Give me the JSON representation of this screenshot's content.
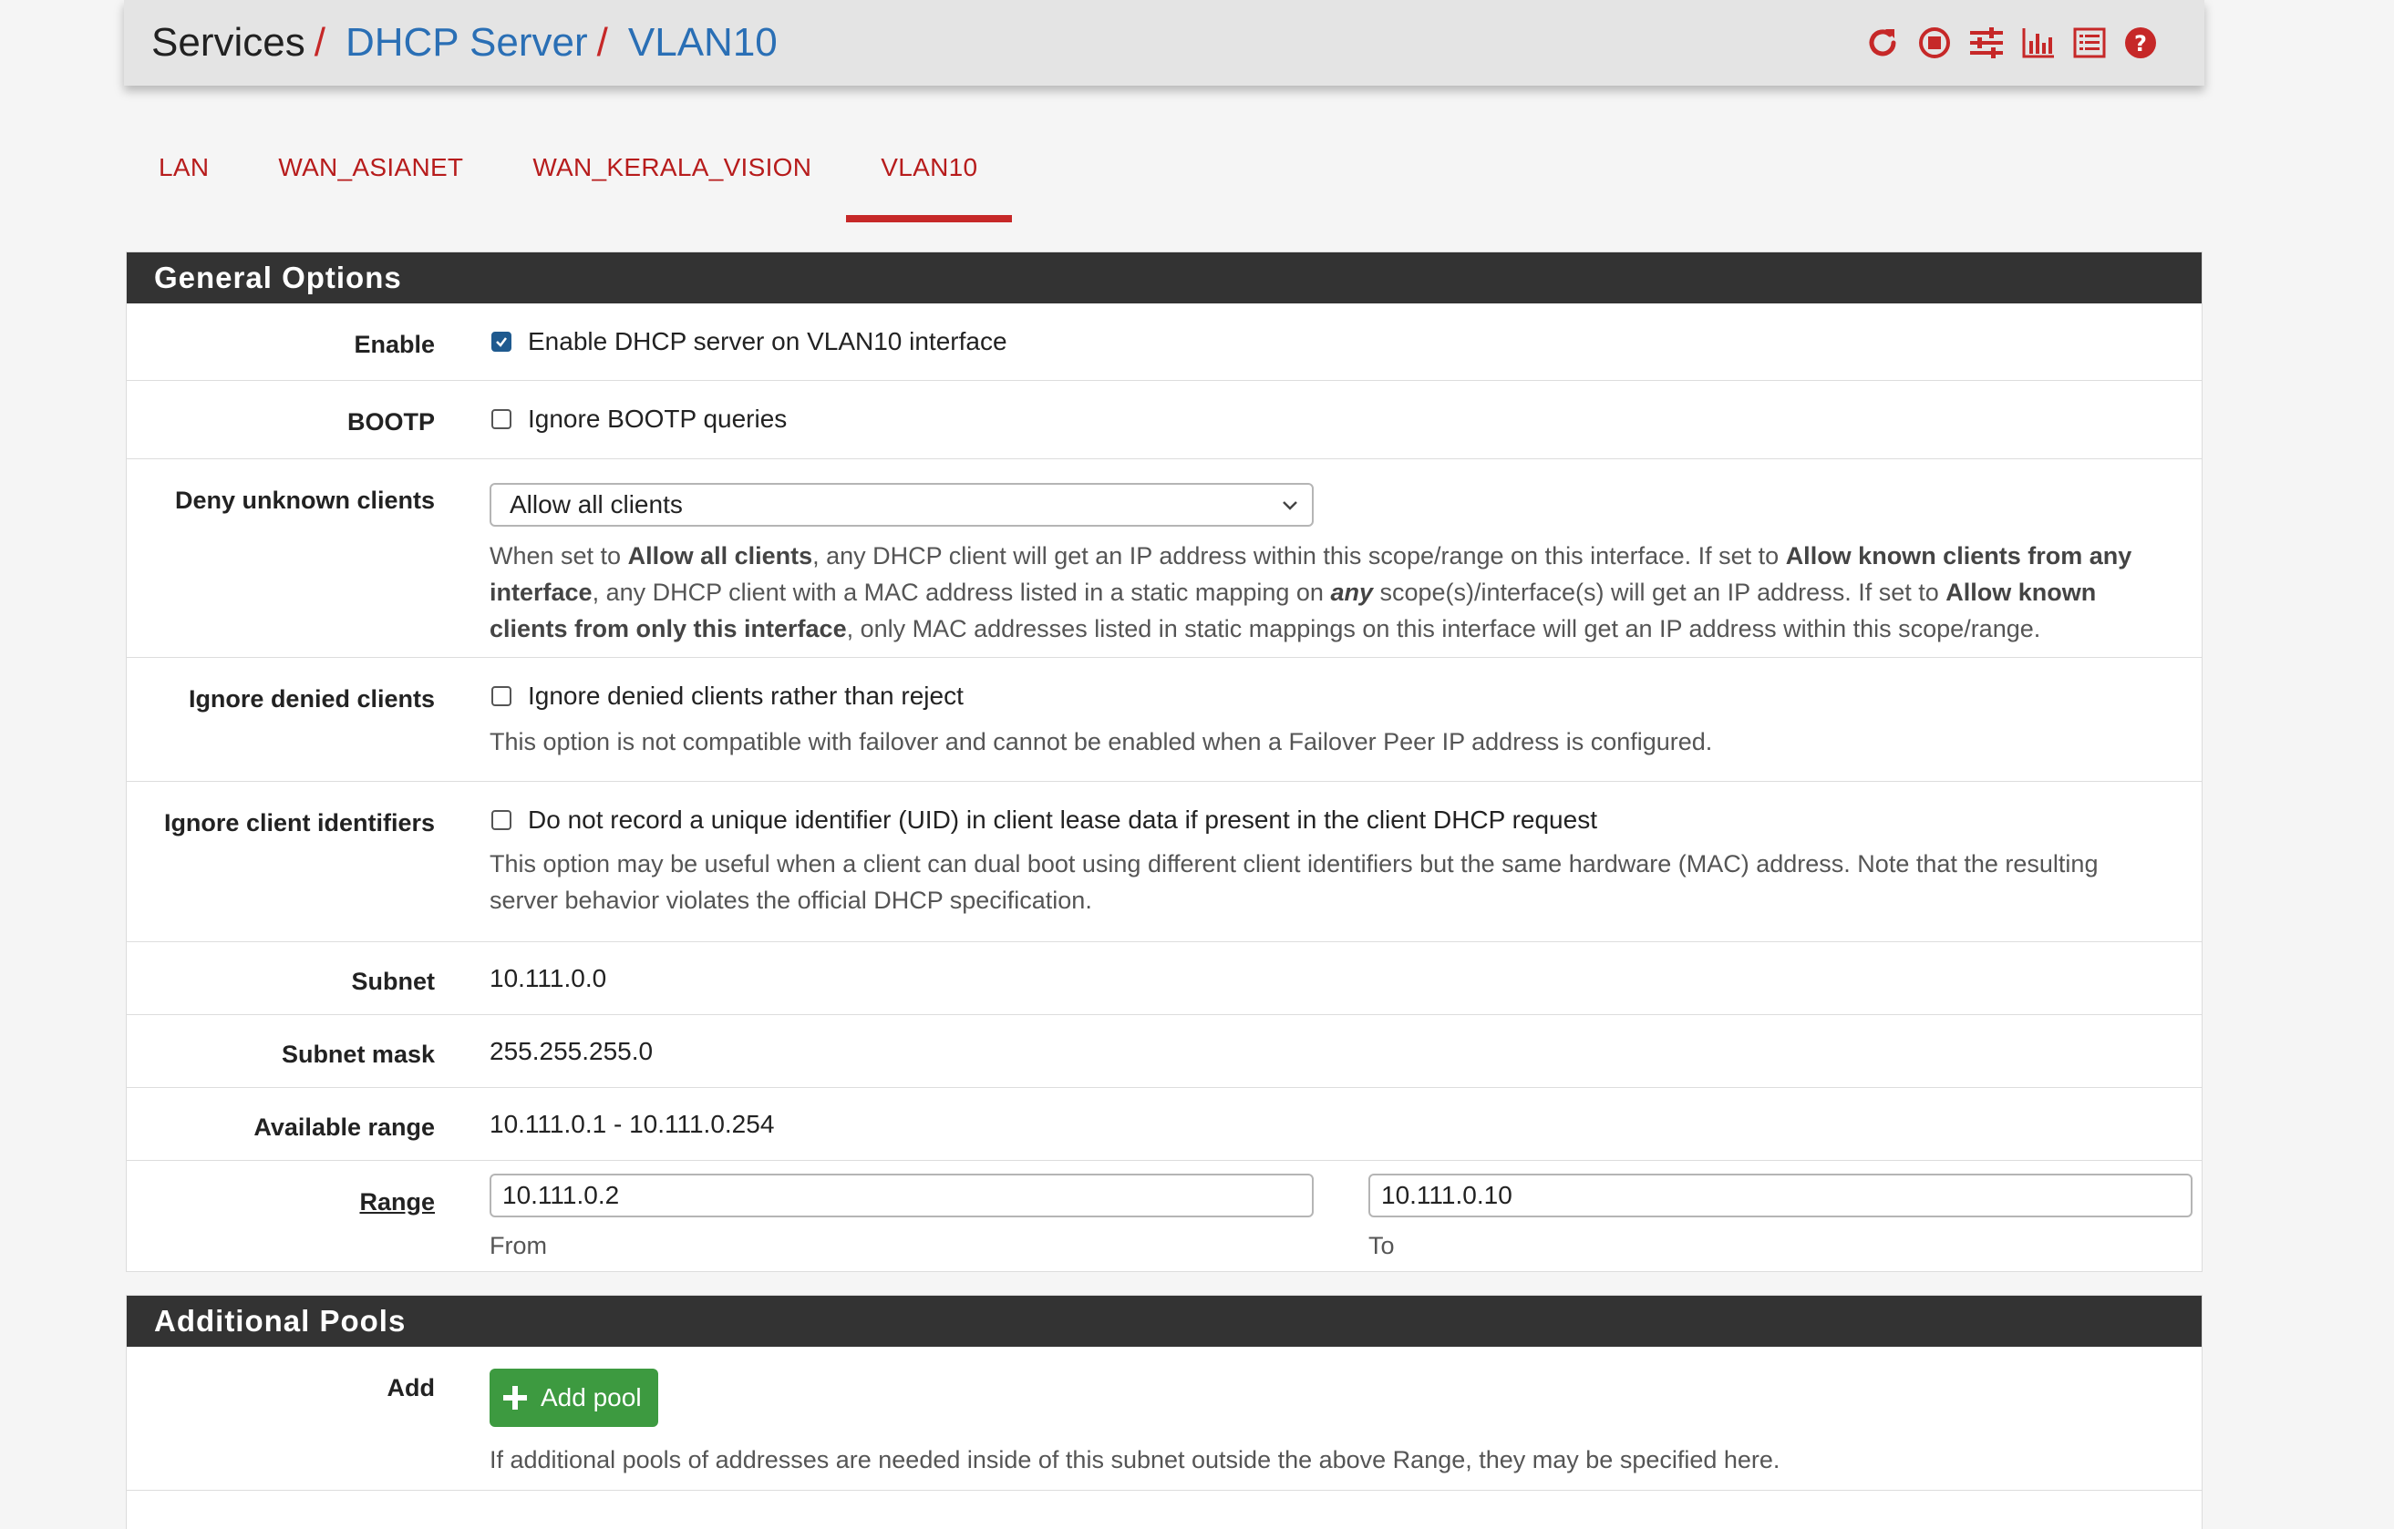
{
  "header": {
    "crumbs": [
      "Services",
      "DHCP Server",
      "VLAN10"
    ],
    "separator": "/",
    "icons": [
      "restart-icon",
      "stop-icon",
      "settings-sliders-icon",
      "chart-icon",
      "log-list-icon",
      "help-icon"
    ],
    "icon_color": "#c62828"
  },
  "tabs": [
    {
      "label": "LAN",
      "active": false
    },
    {
      "label": "WAN_ASIANET",
      "active": false
    },
    {
      "label": "WAN_KERALA_VISION",
      "active": false
    },
    {
      "label": "VLAN10",
      "active": true
    }
  ],
  "general": {
    "title": "General Options",
    "enable": {
      "label": "Enable",
      "checked": true,
      "text": "Enable DHCP server on VLAN10 interface"
    },
    "bootp": {
      "label": "BOOTP",
      "checked": false,
      "text": "Ignore BOOTP queries"
    },
    "deny": {
      "label": "Deny unknown clients",
      "selected": "Allow all clients",
      "help": {
        "p1": "When set to ",
        "b1": "Allow all clients",
        "p2": ", any DHCP client will get an IP address within this scope/range on this interface. If set to ",
        "b2": "Allow known clients from any interface",
        "p3": ", any DHCP client with a MAC address listed in a static mapping on ",
        "b3": "any",
        "p4": " scope(s)/interface(s) will get an IP address. If set to ",
        "b4": "Allow known clients from only this interface",
        "p5": ", only MAC addresses listed in static mappings on this interface will get an IP address within this scope/range."
      }
    },
    "ignore_denied": {
      "label": "Ignore denied clients",
      "checked": false,
      "text": "Ignore denied clients rather than reject",
      "help": "This option is not compatible with failover and cannot be enabled when a Failover Peer IP address is configured."
    },
    "ignore_uid": {
      "label": "Ignore client identifiers",
      "checked": false,
      "text": "Do not record a unique identifier (UID) in client lease data if present in the client DHCP request",
      "help": "This option may be useful when a client can dual boot using different client identifiers but the same hardware (MAC) address. Note that the resulting server behavior violates the official DHCP specification."
    },
    "subnet": {
      "label": "Subnet",
      "value": "10.111.0.0"
    },
    "mask": {
      "label": "Subnet mask",
      "value": "255.255.255.0"
    },
    "available": {
      "label": "Available range",
      "value": "10.111.0.1 - 10.111.0.254"
    },
    "range": {
      "label": "Range",
      "from": "10.111.0.2",
      "from_label": "From",
      "to": "10.111.0.10",
      "to_label": "To"
    }
  },
  "pools": {
    "title": "Additional Pools",
    "add": {
      "label": "Add",
      "button": "Add pool",
      "help": "If additional pools of addresses are needed inside of this subnet outside the above Range, they may be specified here."
    }
  }
}
